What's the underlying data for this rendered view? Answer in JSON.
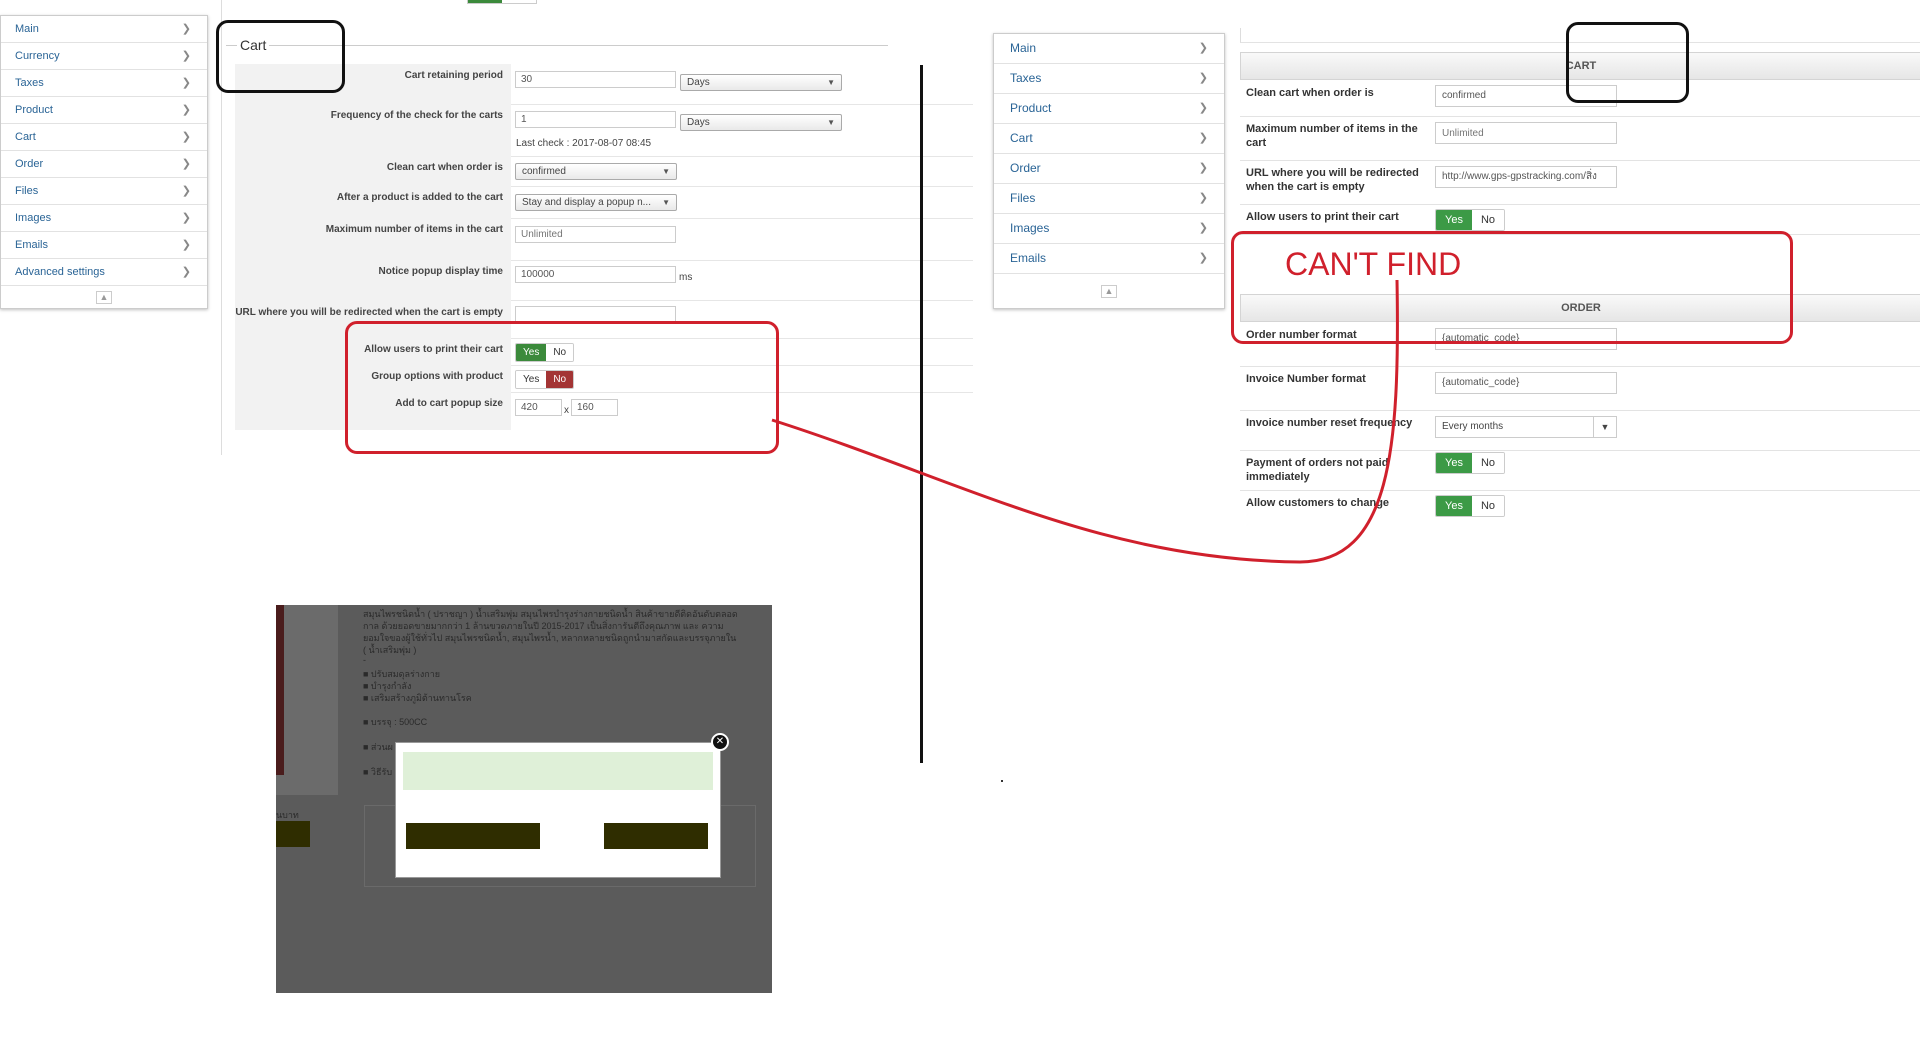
{
  "left_sidebar": {
    "items": [
      "Main",
      "Currency",
      "Taxes",
      "Product",
      "Cart",
      "Order",
      "Files",
      "Images",
      "Emails",
      "Advanced settings"
    ],
    "footer": "▲"
  },
  "left_form": {
    "legend": "Cart",
    "rows": {
      "retaining_period": {
        "label": "Cart retaining period",
        "value": "30",
        "unit": "Days"
      },
      "check_frequency": {
        "label": "Frequency of the check for the carts",
        "value": "1",
        "unit": "Days",
        "last_check": "Last check : 2017-08-07 08:45"
      },
      "clean_cart": {
        "label": "Clean cart when order is",
        "value": "confirmed"
      },
      "after_add": {
        "label": "After a product is added to the cart",
        "value": "Stay and display a popup n..."
      },
      "max_items": {
        "label": "Maximum number of items in the cart",
        "placeholder": "Unlimited"
      },
      "popup_time": {
        "label": "Notice popup display time",
        "value": "100000",
        "suffix": "ms"
      },
      "redirect_url": {
        "label": "URL where you will be redirected when the cart is empty",
        "value": ""
      },
      "print_cart": {
        "label": "Allow users to print their cart",
        "yes": "Yes",
        "no": "No"
      },
      "group_options": {
        "label": "Group options with product",
        "yes": "Yes",
        "no": "No"
      },
      "popup_size": {
        "label": "Add to cart popup size",
        "width": "420",
        "x": "x",
        "height": "160"
      }
    }
  },
  "right_sidebar": {
    "items": [
      "Main",
      "Taxes",
      "Product",
      "Cart",
      "Order",
      "Files",
      "Images",
      "Emails"
    ],
    "footer": "▲"
  },
  "right_panel": {
    "cart_header": "CART",
    "order_header": "ORDER",
    "annotation": "CAN'T FIND",
    "rows": {
      "clean_cart": {
        "label": "Clean cart when order is",
        "value": "confirmed"
      },
      "max_items": {
        "label": "Maximum number of items in the cart",
        "placeholder": "Unlimited"
      },
      "redirect_url": {
        "label": "URL where you will be redirected when the cart is empty",
        "value": "http://www.gps-gpstracking.com/สิ่ง"
      },
      "print_cart": {
        "label": "Allow users to print their cart",
        "yes": "Yes",
        "no": "No"
      },
      "order_number": {
        "label": "Order number format",
        "value": "{automatic_code}"
      },
      "invoice_number": {
        "label": "Invoice Number format",
        "value": "{automatic_code}"
      },
      "invoice_reset": {
        "label": "Invoice number reset frequency",
        "value": "Every months"
      },
      "payment_unpaid": {
        "label": "Payment of orders not paid immediately",
        "yes": "Yes",
        "no": "No"
      },
      "allow_change": {
        "label": "Allow customers to change",
        "yes": "Yes",
        "no": "No"
      }
    }
  },
  "product_shot": {
    "lines": [
      "สมุนไพรชนิดน้ำ ( ปราชญา ) น้ำเสริมพุ่ม สมุนไพรบำรุงร่างกายชนิดน้ำ สินค้าขายดีติดอันดับตลอด",
      "กาล ด้วยยอดขายมากกว่า 1 ล้านขวดภายในปี 2015-2017 เป็นสิ่งการันตีถึงคุณภาพ และ ความ",
      "ยอมใจของผู้ใช้ทั่วไป สมุนไพรชนิดน้ำ, สมุนไพรน้ำ, หลากหลายชนิดถูกนำมาสกัดและบรรจุภายใน",
      "( น้ำเสริมพุ่ม )",
      "-",
      "■ ปรับสมดุลร่างกาย",
      "■ บำรุงกำลัง",
      "■ เสริมสร้างภูมิต้านทานโรค",
      "■ บรรจุ : 500CC",
      "■ ส่วนผ",
      "■ วิธีรับ"
    ],
    "side_label": "นบาท"
  },
  "colors": {
    "accent_red": "#d0202c",
    "yes_green": "#3b8a3b",
    "no_red": "#a33434"
  }
}
